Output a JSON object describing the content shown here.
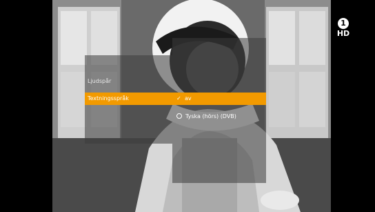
{
  "channel": {
    "logo_icon": "das-erste-1-icon",
    "hd_label": "HD"
  },
  "main_menu": {
    "items": [
      {
        "label": "Ljudspår",
        "active": false
      },
      {
        "label": "Textningsspråk",
        "active": true
      }
    ]
  },
  "sub_menu": {
    "options": [
      {
        "label": "av",
        "selected": true,
        "marker": "check-icon"
      },
      {
        "label": "Tyska (hörs) (DVB)",
        "selected": false,
        "marker": "radio-icon"
      }
    ]
  },
  "colors": {
    "highlight": "#f29a00",
    "panel": "#3c3c3c",
    "text": "#ffffff"
  }
}
